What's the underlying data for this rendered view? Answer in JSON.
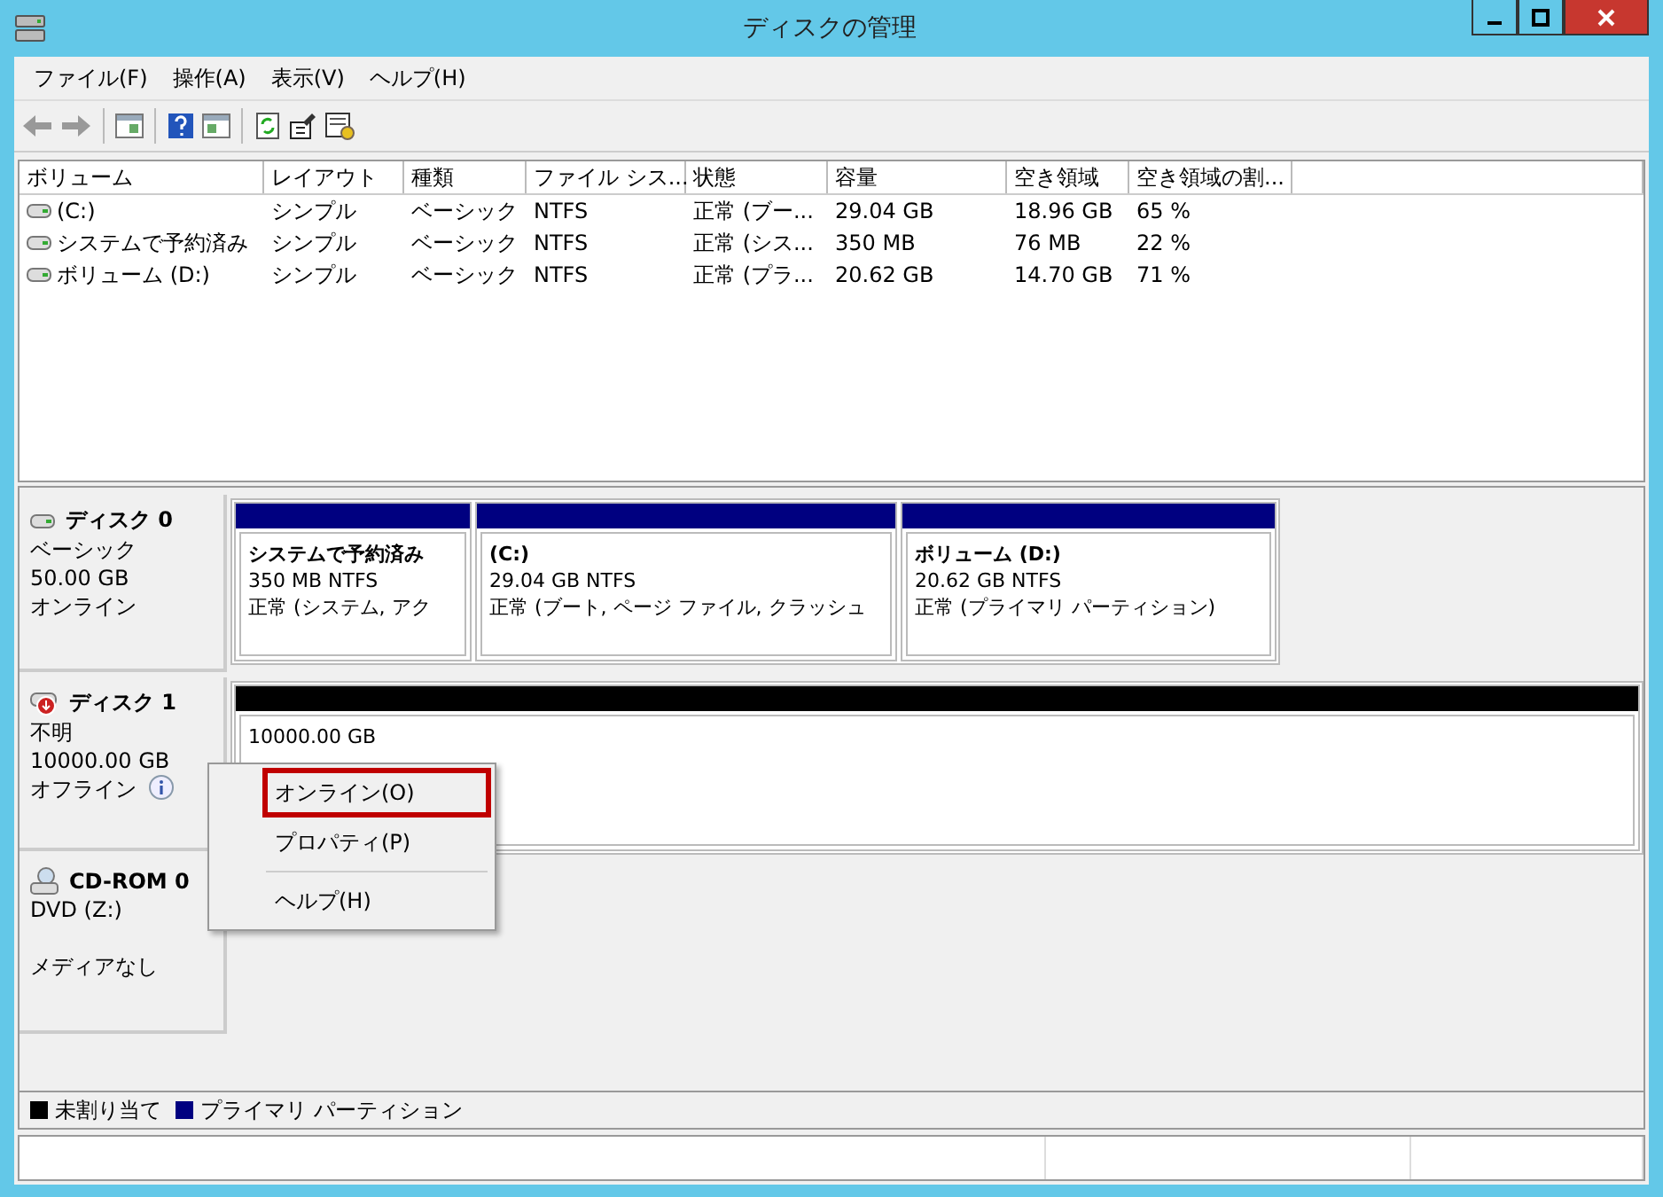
{
  "window": {
    "title": "ディスクの管理"
  },
  "menu": [
    "ファイル(F)",
    "操作(A)",
    "表示(V)",
    "ヘルプ(H)"
  ],
  "volume_table": {
    "columns": [
      "ボリューム",
      "レイアウト",
      "種類",
      "ファイル シス...",
      "状態",
      "容量",
      "空き領域",
      "空き領域の割..."
    ],
    "rows": [
      [
        "(C:)",
        "シンプル",
        "ベーシック",
        "NTFS",
        "正常 (ブー...",
        "29.04 GB",
        "18.96 GB",
        "65 %"
      ],
      [
        "システムで予約済み",
        "シンプル",
        "ベーシック",
        "NTFS",
        "正常 (シス...",
        "350 MB",
        "76 MB",
        "22 %"
      ],
      [
        "ボリューム (D:)",
        "シンプル",
        "ベーシック",
        "NTFS",
        "正常 (プラ...",
        "20.62 GB",
        "14.70 GB",
        "71 %"
      ]
    ]
  },
  "disks": [
    {
      "kind": "disk",
      "name": "ディスク 0",
      "lines": [
        "ベーシック",
        "50.00 GB",
        "オンライン"
      ],
      "offline": false,
      "partitions": [
        {
          "name": "システムで予約済み",
          "size": "350 MB NTFS",
          "status": "正常 (システム, アク",
          "color": "#000080"
        },
        {
          "name": "(C:)",
          "size": "29.04 GB NTFS",
          "status": "正常 (ブート, ページ ファイル, クラッシュ",
          "color": "#000080"
        },
        {
          "name": "ボリューム (D:)",
          "size": "20.62 GB NTFS",
          "status": "正常 (プライマリ パーティション)",
          "color": "#000080"
        }
      ]
    },
    {
      "kind": "disk",
      "name": "ディスク 1",
      "lines": [
        "不明",
        "10000.00 GB",
        "オフライン"
      ],
      "offline": true,
      "partitions": [
        {
          "size": "10000.00 GB",
          "color": "#000000"
        }
      ]
    },
    {
      "kind": "cdrom",
      "name": "CD-ROM 0",
      "lines": [
        "DVD (Z:)"
      ],
      "note": "メディアなし",
      "offline": false
    }
  ],
  "context_menu": [
    {
      "label": "オンライン(O)",
      "highlighted": true
    },
    {
      "label": "プロパティ(P)",
      "highlighted": false
    },
    {
      "label": "ヘルプ(H)",
      "highlighted": false
    }
  ],
  "legend": [
    {
      "label": "未割り当て",
      "color": "#000000"
    },
    {
      "label": "プライマリ パーティション",
      "color": "#000080"
    }
  ]
}
